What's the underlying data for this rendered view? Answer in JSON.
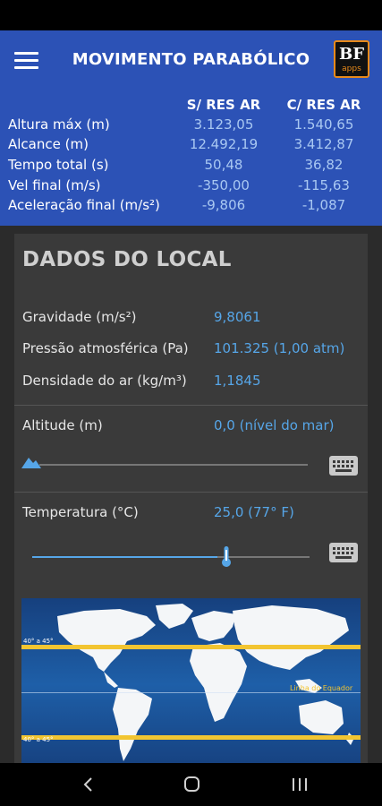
{
  "header": {
    "title": "MOVIMENTO PARABÓLICO",
    "logo_text": "BF",
    "logo_sub": "apps",
    "col_no_air": "S/ RES AR",
    "col_with_air": "C/ RES AR",
    "rows": [
      {
        "label": "Altura máx (m)",
        "no_air": "3.123,05",
        "with_air": "1.540,65"
      },
      {
        "label": "Alcance (m)",
        "no_air": "12.492,19",
        "with_air": "3.412,87"
      },
      {
        "label": "Tempo total (s)",
        "no_air": "50,48",
        "with_air": "36,82"
      },
      {
        "label": "Vel final (m/s)",
        "no_air": "-350,00",
        "with_air": "-115,63"
      },
      {
        "label": "Aceleração final (m/s²)",
        "no_air": "-9,806",
        "with_air": "-1,087"
      }
    ]
  },
  "card": {
    "title": "DADOS DO LOCAL",
    "gravity_label": "Gravidade (m/s²)",
    "gravity_value": "9,8061",
    "pressure_label": "Pressão atmosférica (Pa)",
    "pressure_value": "101.325 (1,00 atm)",
    "density_label": "Densidade do ar (kg/m³)",
    "density_value": "1,1845",
    "altitude_label": "Altitude (m)",
    "altitude_value": "0,0 (nível do mar)",
    "altitude_slider": 0.0,
    "temperature_label": "Temperatura (°C)",
    "temperature_value": "25,0 (77° F)",
    "temperature_slider": 0.7
  },
  "map": {
    "lat_north_label": "40° a 45°",
    "lat_south_label": "40° a 45°",
    "equator_label": "Linha do Equador"
  },
  "colors": {
    "header_bg": "#2c52b6",
    "accent": "#56a6e8",
    "latitude_band": "#f2c531"
  }
}
